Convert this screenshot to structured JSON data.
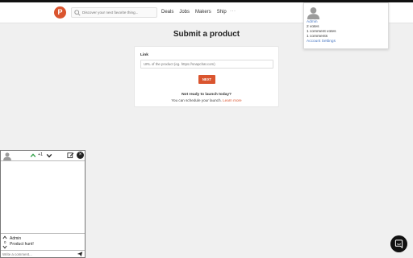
{
  "navbar": {
    "logo_letter": "P",
    "search_placeholder": "Discover your next favorite thing...",
    "links": [
      "Deals",
      "Jobs",
      "Makers",
      "Ship"
    ],
    "more": "···"
  },
  "account_menu": {
    "name": "Admin",
    "votes": "2 votes",
    "comment_votes": "1 comment votes",
    "comments": "1 comments",
    "settings": "Account Settings"
  },
  "page": {
    "title": "Submit a product",
    "link_label": "Link",
    "link_placeholder": "URL of the product (eg. https://snapchat.com)",
    "next_button": "NEXT",
    "not_ready": "Not ready to launch today?",
    "schedule_text": "You can schedule your launch.",
    "learn_more": "Learn more"
  },
  "comment_panel": {
    "vote_count": "+1",
    "thread": {
      "count": "0",
      "author": "Admin",
      "text": "Product hunt!"
    },
    "comment_placeholder": "Write a comment..."
  },
  "colors": {
    "brand": "#da552f",
    "link_blue": "#4a78c2",
    "upvote_green": "#2e9e45"
  }
}
